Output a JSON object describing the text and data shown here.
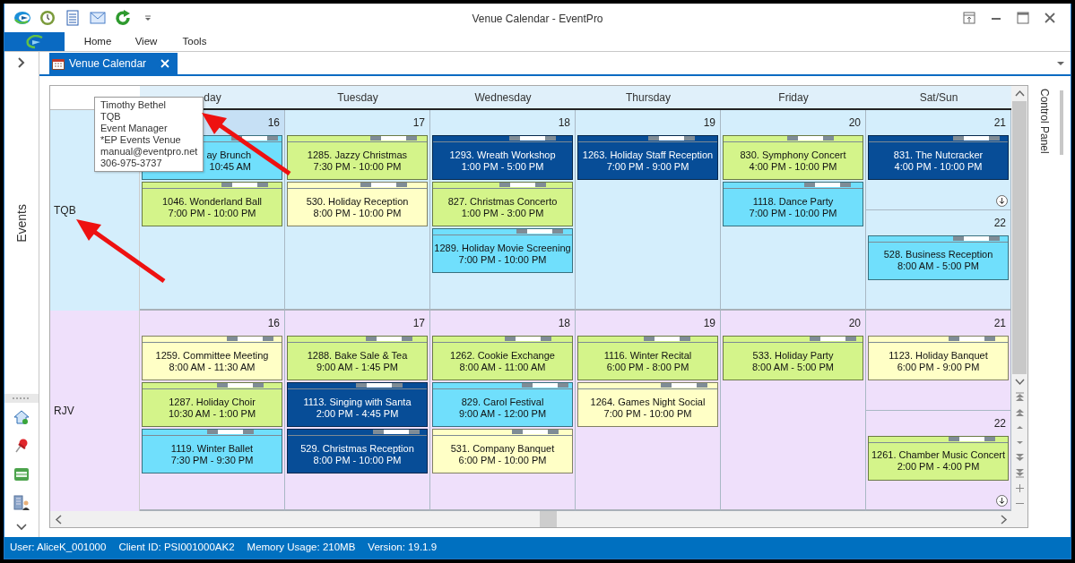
{
  "window": {
    "title": "Venue Calendar - EventPro"
  },
  "ribbon": {
    "tabs": [
      {
        "label": "Home"
      },
      {
        "label": "View"
      },
      {
        "label": "Tools"
      }
    ]
  },
  "nav": {
    "title": "Events"
  },
  "document_tabs": [
    {
      "label": "Venue Calendar",
      "selected": true
    }
  ],
  "calendar": {
    "columns": [
      {
        "label": "day"
      },
      {
        "label": "Tuesday"
      },
      {
        "label": "Wednesday"
      },
      {
        "label": "Thursday"
      },
      {
        "label": "Friday"
      },
      {
        "label": "Sat/Sun"
      }
    ],
    "rows": [
      {
        "label": "TQB",
        "color": "#d4eefc",
        "cells": [
          [
            {
              "date": "16",
              "highlighted": true,
              "more": false,
              "events": [
                {
                  "kind": "partial",
                  "title": "ay Brunch",
                  "time": "10:45 AM",
                  "color": "#70dffc"
                },
                {
                  "kind": "full",
                  "title": "1046. Wonderland Ball",
                  "time": "7:00 PM - 10:00 PM",
                  "color": "#d4f48a"
                }
              ]
            }
          ],
          [
            {
              "date": "17",
              "highlighted": false,
              "more": false,
              "events": [
                {
                  "kind": "full",
                  "title": "1285. Jazzy Christmas",
                  "time": "7:30 PM - 10:00 PM",
                  "color": "#d4f48a"
                },
                {
                  "kind": "full",
                  "title": "530. Holiday Reception",
                  "time": "8:00 PM - 10:00 PM",
                  "color": "#ffffc6"
                }
              ]
            }
          ],
          [
            {
              "date": "18",
              "highlighted": false,
              "more": false,
              "events": [
                {
                  "kind": "full",
                  "title": "1293. Wreath Workshop",
                  "time": "1:00 PM - 5:00 PM",
                  "color": "#074d97"
                },
                {
                  "kind": "full",
                  "title": "827. Christmas Concerto",
                  "time": "1:00 PM - 3:00 PM",
                  "color": "#d4f48a"
                },
                {
                  "kind": "full",
                  "title": "1289. Holiday Movie Screening",
                  "time": "7:00 PM - 10:00 PM",
                  "color": "#70dffc"
                }
              ]
            }
          ],
          [
            {
              "date": "19",
              "highlighted": false,
              "more": false,
              "events": [
                {
                  "kind": "full",
                  "title": "1263. Holiday Staff Reception",
                  "time": "7:00 PM - 9:00 PM",
                  "color": "#074d97"
                }
              ]
            }
          ],
          [
            {
              "date": "20",
              "highlighted": false,
              "more": false,
              "events": [
                {
                  "kind": "full",
                  "title": "830. Symphony Concert",
                  "time": "4:00 PM - 10:00 PM",
                  "color": "#d4f48a"
                },
                {
                  "kind": "full",
                  "title": "1118. Dance Party",
                  "time": "7:00 PM - 10:00 PM",
                  "color": "#70dffc"
                }
              ]
            }
          ],
          [
            {
              "date": "21",
              "highlighted": false,
              "more": true,
              "events": [
                {
                  "kind": "full",
                  "title": "831. The Nutcracker",
                  "time": "4:00 PM - 10:00 PM",
                  "color": "#074d97"
                }
              ]
            },
            {
              "date": "22",
              "highlighted": false,
              "more": false,
              "events": [
                {
                  "kind": "full",
                  "title": "528. Business Reception",
                  "time": "8:00 AM - 5:00 PM",
                  "color": "#70dffc"
                }
              ]
            }
          ]
        ]
      },
      {
        "label": "RJV",
        "color": "#efe0fb",
        "cells": [
          [
            {
              "date": "16",
              "highlighted": false,
              "more": false,
              "events": [
                {
                  "kind": "full",
                  "title": "1259. Committee Meeting",
                  "time": "8:00 AM - 11:30 AM",
                  "color": "#ffffc6"
                },
                {
                  "kind": "full",
                  "title": "1287. Holiday Choir",
                  "time": "10:30 AM - 1:00 PM",
                  "color": "#d4f48a"
                },
                {
                  "kind": "full",
                  "title": "1119. Winter Ballet",
                  "time": "7:30 PM - 9:30 PM",
                  "color": "#70dffc"
                }
              ]
            }
          ],
          [
            {
              "date": "17",
              "highlighted": false,
              "more": false,
              "events": [
                {
                  "kind": "full",
                  "title": "1288. Bake Sale & Tea",
                  "time": "9:00 AM - 1:45 PM",
                  "color": "#d4f48a"
                },
                {
                  "kind": "full",
                  "title": "1113. Singing with Santa",
                  "time": "2:00 PM - 4:45 PM",
                  "color": "#074d97"
                },
                {
                  "kind": "full",
                  "title": "529. Christmas Reception",
                  "time": "8:00 PM - 10:00 PM",
                  "color": "#074d97"
                }
              ]
            }
          ],
          [
            {
              "date": "18",
              "highlighted": false,
              "more": false,
              "events": [
                {
                  "kind": "full",
                  "title": "1262. Cookie Exchange",
                  "time": "8:00 AM - 11:00 AM",
                  "color": "#d4f48a"
                },
                {
                  "kind": "full",
                  "title": "829. Carol Festival",
                  "time": "9:00 AM - 12:00 PM",
                  "color": "#70dffc"
                },
                {
                  "kind": "full",
                  "title": "531. Company Banquet",
                  "time": "6:00 PM - 10:00 PM",
                  "color": "#ffffc6"
                }
              ]
            }
          ],
          [
            {
              "date": "19",
              "highlighted": false,
              "more": false,
              "events": [
                {
                  "kind": "full",
                  "title": "1116. Winter Recital",
                  "time": "6:00 PM - 8:00 PM",
                  "color": "#d4f48a"
                },
                {
                  "kind": "full",
                  "title": "1264. Games Night Social",
                  "time": "7:00 PM - 10:00 PM",
                  "color": "#ffffc6"
                }
              ]
            }
          ],
          [
            {
              "date": "20",
              "highlighted": false,
              "more": false,
              "events": [
                {
                  "kind": "full",
                  "title": "533. Holiday Party",
                  "time": "8:00 AM - 5:00 PM",
                  "color": "#d4f48a"
                }
              ]
            }
          ],
          [
            {
              "date": "21",
              "highlighted": false,
              "more": false,
              "events": [
                {
                  "kind": "full",
                  "title": "1123. Holiday Banquet",
                  "time": "6:00 PM - 9:00 PM",
                  "color": "#ffffc6"
                }
              ]
            },
            {
              "date": "22",
              "highlighted": false,
              "more": true,
              "events": [
                {
                  "kind": "full",
                  "title": "1261. Chamber Music Concert",
                  "time": "2:00 PM - 4:00 PM",
                  "color": "#d4f48a"
                }
              ]
            }
          ]
        ]
      }
    ]
  },
  "tooltip": {
    "lines": [
      "Timothy Bethel",
      "TQB",
      "Event Manager",
      "*EP Events Venue",
      "manual@eventpro.net",
      "306-975-3737"
    ]
  },
  "side_panel": {
    "title": "Control Panel"
  },
  "status_bar": {
    "items": [
      "User: AliceK_001000",
      "Client ID: PSI001000AK2",
      "Memory Usage: 210MB",
      "Version: 19.1.9"
    ]
  }
}
